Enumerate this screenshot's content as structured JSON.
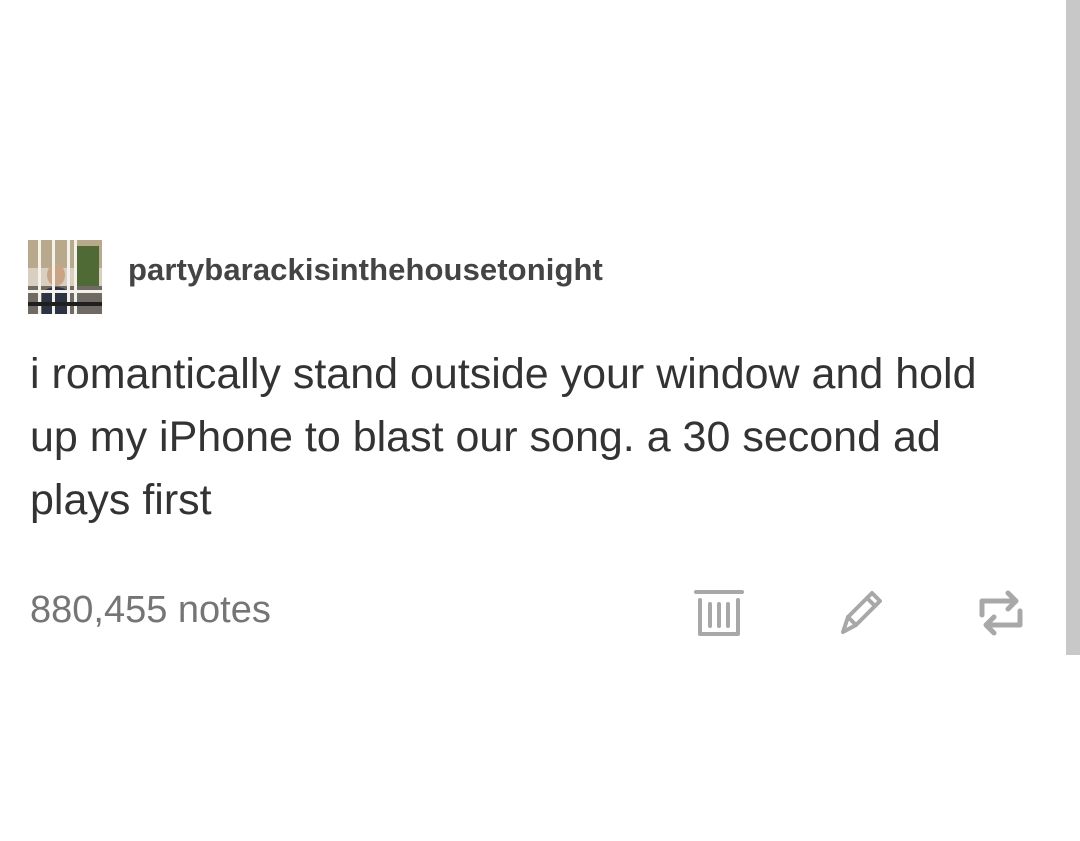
{
  "post": {
    "username": "partybarackisinthehousetonight",
    "body": "i romantically stand outside your window and hold up my iPhone to blast our song. a 30 second ad plays first",
    "notes": "880,455 notes"
  },
  "actions": [
    {
      "name": "delete",
      "icon": "trash-icon"
    },
    {
      "name": "edit",
      "icon": "pencil-icon"
    },
    {
      "name": "reblog",
      "icon": "reblog-icon"
    }
  ],
  "colors": {
    "background": "#ffffff",
    "username": "#444444",
    "body_text": "#333333",
    "notes_text": "#757575",
    "icon": "#a8a8a8",
    "scrollbar": "#c8c8c8"
  }
}
